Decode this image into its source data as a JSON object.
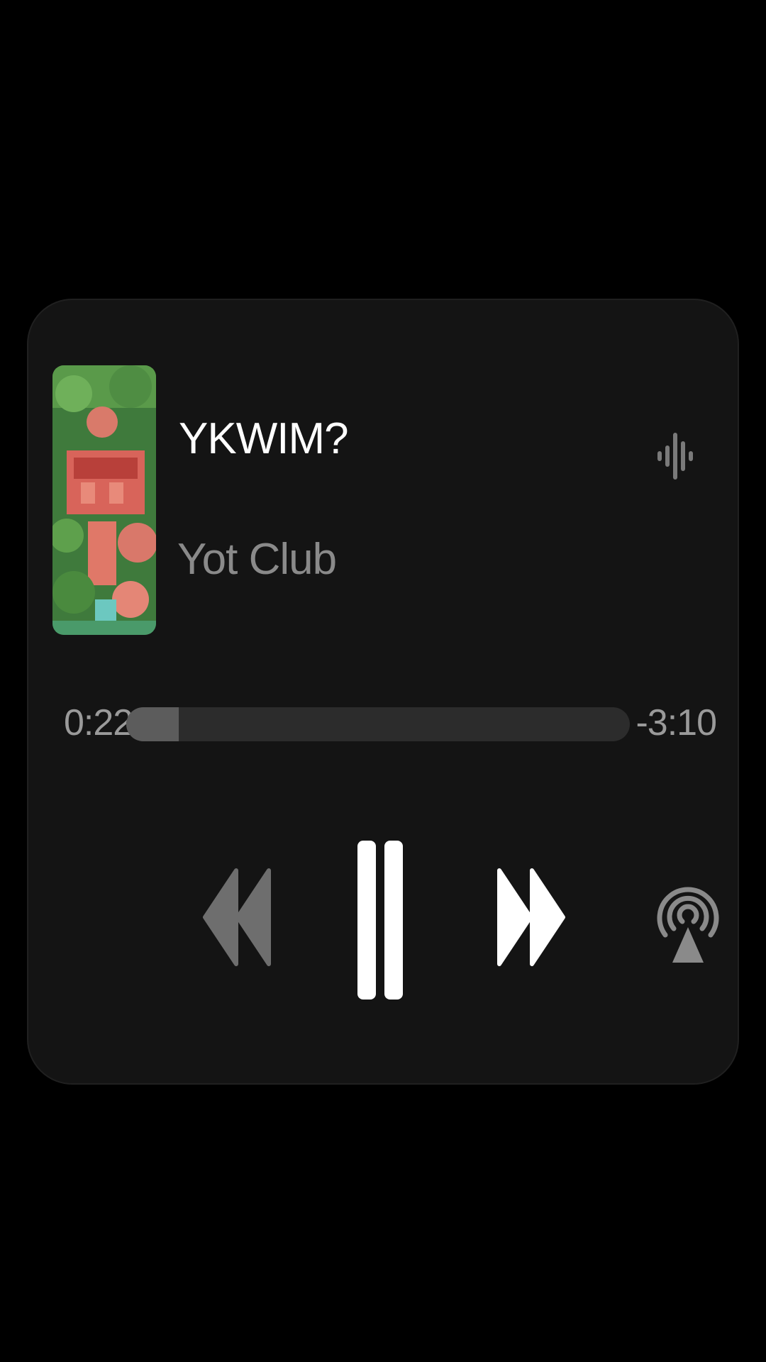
{
  "track": {
    "title": "YKWIM?",
    "artist": "Yot Club"
  },
  "playback": {
    "elapsed": "0:22",
    "remaining": "-3:10",
    "progress_fraction": 0.104,
    "state": "playing"
  },
  "icons": {
    "waveform": "waveform-icon",
    "rewind": "rewind-icon",
    "pause": "pause-icon",
    "forward": "fast-forward-icon",
    "airplay": "airplay-icon"
  },
  "colors": {
    "background": "#000000",
    "card": "#141414",
    "title": "#ffffff",
    "artist": "#8a8a8a",
    "progress_track": "#2c2c2c",
    "progress_fill": "#5c5c5c"
  }
}
